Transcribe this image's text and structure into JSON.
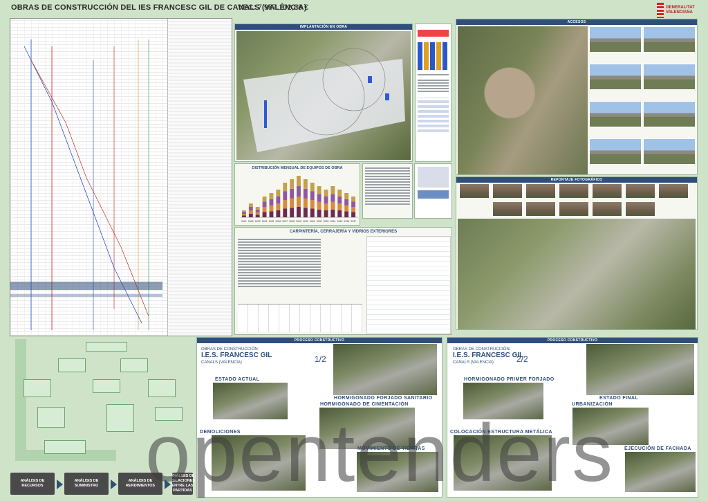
{
  "header": {
    "title": "OBRAS DE CONSTRUCCIÓN DEL IES FRANCESC GIL DE CANALS (VALÈNCIA)",
    "vec": "VEC: 7.987.102,88 €"
  },
  "logo": {
    "line1": "GENERALITAT",
    "line2": "VALENCIANA"
  },
  "implantacion": {
    "title": "IMPLANTACIÓN EN OBRA"
  },
  "distribucion": {
    "title": "DISTRIBUCIÓN MENSUAL DE EQUIPOS DE OBRA",
    "categories": [
      "2021",
      "2022",
      "2023",
      "2024",
      "2025",
      "2026",
      "2027",
      "2028",
      "2029",
      "2030",
      "2031",
      "2032",
      "2033",
      "2034",
      "2035",
      "2036",
      "2037"
    ],
    "values": [
      2,
      4,
      3,
      6,
      7,
      8,
      10,
      11,
      12,
      11,
      10,
      9,
      8,
      9,
      8,
      7,
      6
    ],
    "colors": [
      "#6b2c4f",
      "#d98a3c",
      "#8d5aa0",
      "#c3a14a"
    ]
  },
  "carpinteria": {
    "title": "CARPINTERÍA, CERRAJERÍA Y VIDRIOS EXTERIORES"
  },
  "accesos": {
    "title": "ACCESOS"
  },
  "reportaje": {
    "title": "REPORTAJE FOTOGRÁFICO"
  },
  "proceso": {
    "title_left": "PROCESO CONSTRUCTIVO",
    "title_right": "PROCESO CONSTRUCTIVO",
    "obras_label": "OBRAS DE CONSTRUCCIÓN:",
    "school": "I.E.S. FRANCESC GIL",
    "town": "CANALS (VALENCIA)",
    "part1": "1/2",
    "part2": "2/2",
    "stages_left": [
      "ESTADO ACTUAL",
      "HORMIGONADO FORJADO SANITARIO",
      "HORMIGONADO DE CIMENTACIÓN",
      "DEMOLICIONES",
      "MOVIMIENTO DE TIERRAS"
    ],
    "stages_right": [
      "HORMIGONADO PRIMER FORJADO",
      "ESTADO FINAL",
      "URBANIZACIÓN",
      "COLOCACIÓN ESTRUCTURA METÁLICA",
      "EJECUCIÓN DE FACHADA"
    ]
  },
  "flow": {
    "steps": [
      "ANÁLISIS DE RECURSOS",
      "ANÁLISIS DE SUMINISTRO",
      "ANÁLISIS DE RENDIMIENTOS",
      "ANÁLISIS DE RELACIONES ENTRE LAS PARTIDAS"
    ]
  },
  "watermark": "opentenders"
}
